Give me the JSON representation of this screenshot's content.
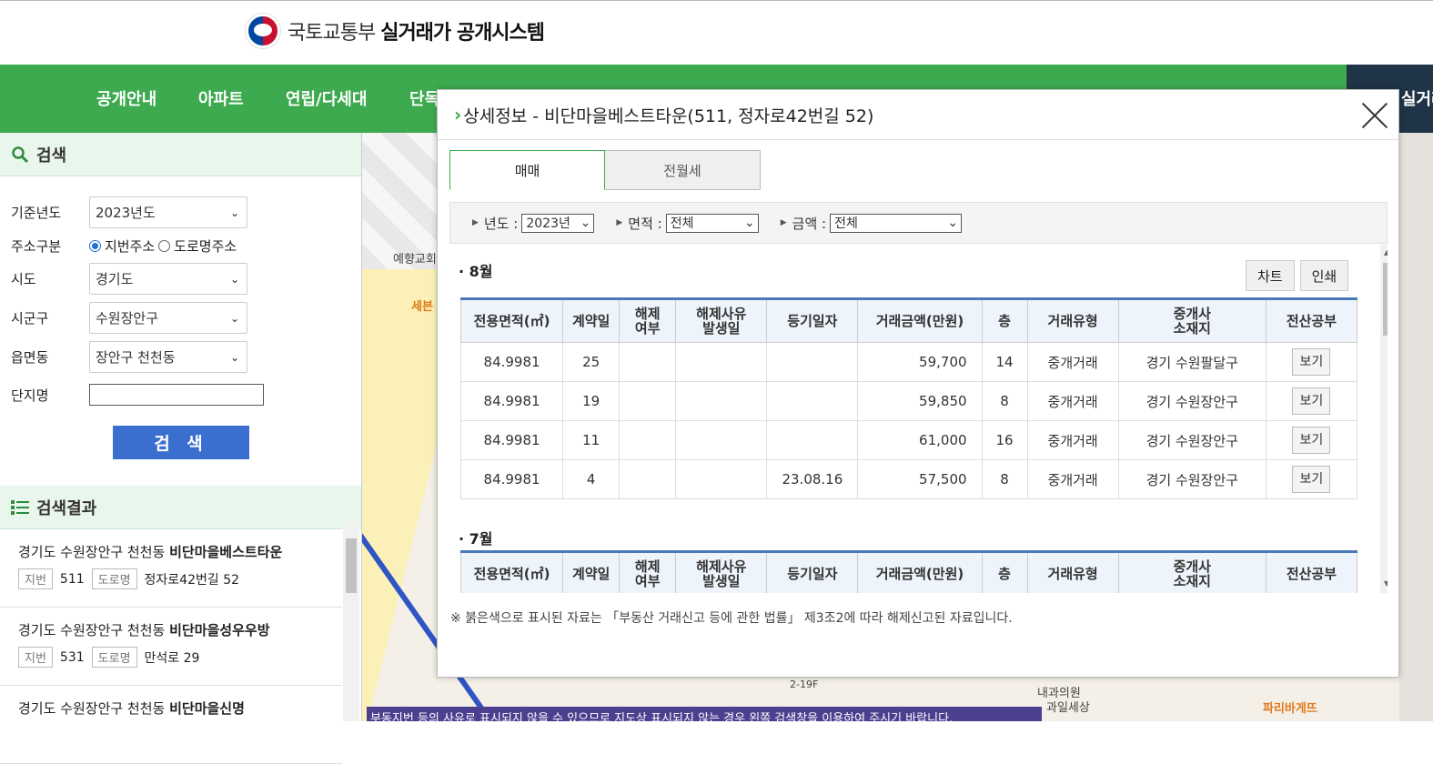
{
  "header": {
    "org": "국토교통부",
    "system": "실거래가 공개시스템"
  },
  "nav": {
    "items": [
      "공개안내",
      "아파트",
      "연립/다세대",
      "단독"
    ],
    "right": "실거래"
  },
  "search": {
    "title": "검색",
    "fields": {
      "year_label": "기준년도",
      "year_value": "2023년도",
      "addr_type_label": "주소구분",
      "addr_jibun": "지번주소",
      "addr_road": "도로명주소",
      "sido_label": "시도",
      "sido_value": "경기도",
      "sigungu_label": "시군구",
      "sigungu_value": "수원장안구",
      "eup_label": "읍면동",
      "eup_value": "장안구 천천동",
      "complex_label": "단지명",
      "complex_value": ""
    },
    "button": "검 색"
  },
  "results": {
    "title": "검색결과",
    "items": [
      {
        "prefix": "경기도 수원장안구 천천동 ",
        "name": "비단마을베스트타운",
        "jibun_tag": "지번",
        "jibun": "511",
        "road_tag": "도로명",
        "road": "정자로42번길 52"
      },
      {
        "prefix": "경기도 수원장안구 천천동 ",
        "name": "비단마을성우우방",
        "jibun_tag": "지번",
        "jibun": "531",
        "road_tag": "도로명",
        "road": "만석로 29"
      },
      {
        "prefix": "경기도 수원장안구 천천동 ",
        "name": "비단마을신명",
        "jibun_tag": "",
        "jibun": "",
        "road_tag": "",
        "road": ""
      }
    ]
  },
  "map": {
    "labels": [
      "예향교회",
      "세븐",
      "과일세상",
      "내과의원",
      "파리바게뜨",
      "2-19F"
    ],
    "banner": "부동지번 등의 사유로 표시되지 않을 수 있으므로 지도상 표시되지 않는 경우 왼쪽 검색창을 이용하여 주시기 바랍니다."
  },
  "modal": {
    "title": "상세정보 - 비단마을베스트타운(511, 정자로42번길 52)",
    "tabs": [
      "매매",
      "전월세"
    ],
    "filters": {
      "year_label": "년도 :",
      "year_value": "2023년",
      "area_label": "면적 :",
      "area_value": "전체",
      "amount_label": "금액 :",
      "amount_value": "전체"
    },
    "buttons": {
      "chart": "차트",
      "print": "인쇄"
    },
    "columns": [
      "전용면적(㎡)",
      "계약일",
      "해제\n여부",
      "해제사유\n발생일",
      "등기일자",
      "거래금액(만원)",
      "층",
      "거래유형",
      "중개사\n소재지",
      "전산공부"
    ],
    "months": [
      {
        "label": "8월",
        "rows": [
          [
            "84.9981",
            "25",
            "",
            "",
            "",
            "59,700",
            "14",
            "중개거래",
            "경기 수원팔달구",
            "보기"
          ],
          [
            "84.9981",
            "19",
            "",
            "",
            "",
            "59,850",
            "8",
            "중개거래",
            "경기 수원장안구",
            "보기"
          ],
          [
            "84.9981",
            "11",
            "",
            "",
            "",
            "61,000",
            "16",
            "중개거래",
            "경기 수원장안구",
            "보기"
          ],
          [
            "84.9981",
            "4",
            "",
            "",
            "23.08.16",
            "57,500",
            "8",
            "중개거래",
            "경기 수원장안구",
            "보기"
          ]
        ]
      },
      {
        "label": "7월",
        "rows": []
      }
    ],
    "note": "※ 붉은색으로 표시된 자료는 「부동산 거래신고 등에 관한 법률」 제3조2에 따라 해제신고된 자료입니다."
  }
}
